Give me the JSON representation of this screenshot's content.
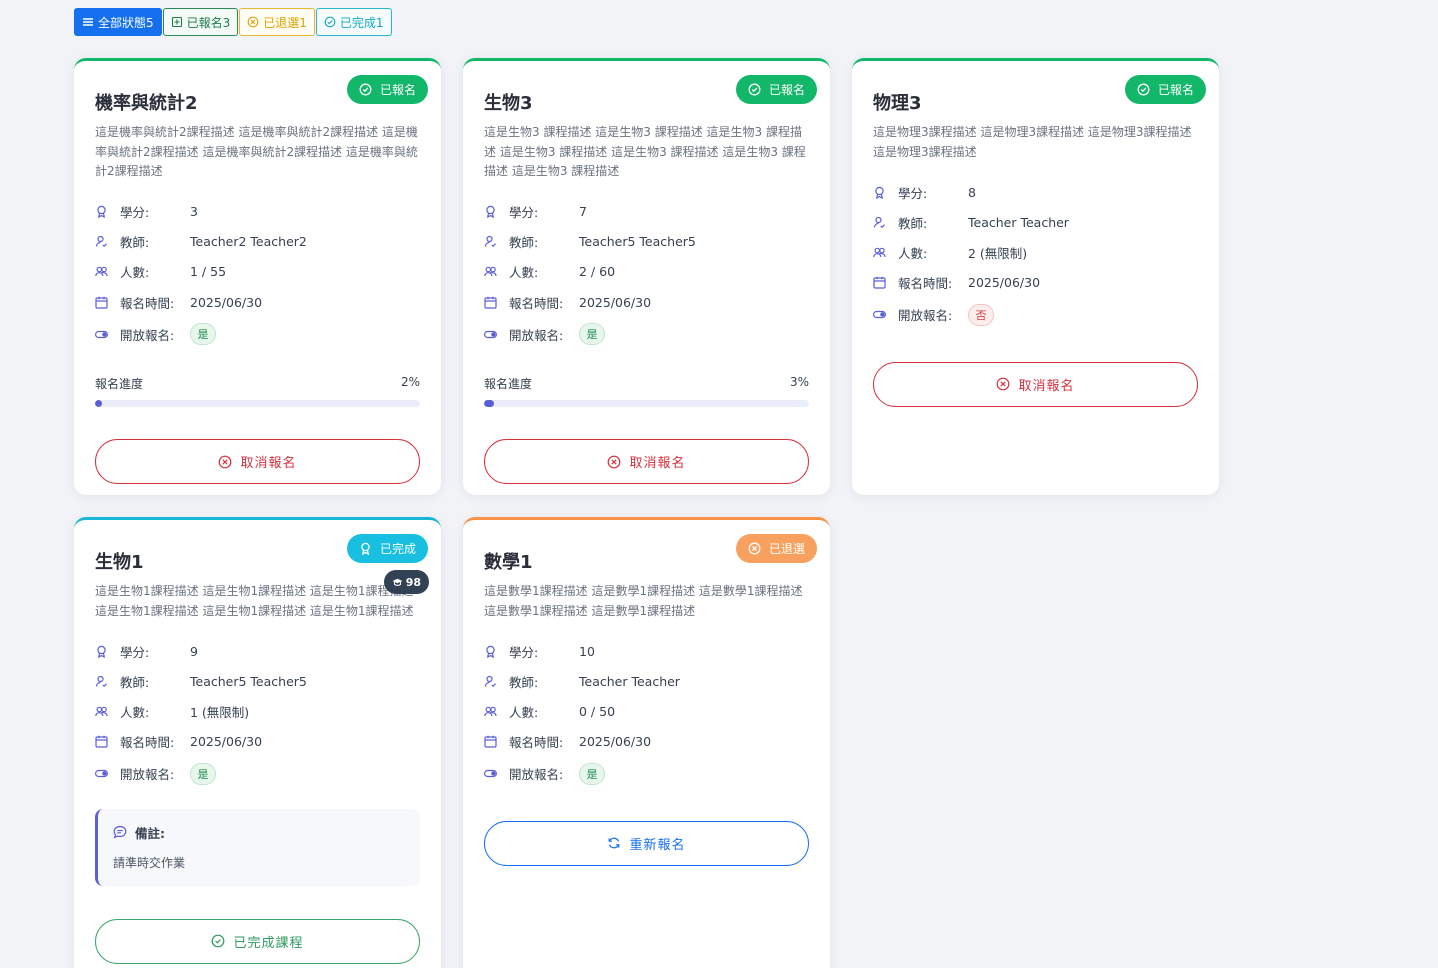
{
  "colors": {
    "primary": "#1570ef",
    "registered": "#12b76a",
    "completed": "#18bfe0",
    "withdrawn": "#f8a15e",
    "cancel": "#d6313d",
    "progress": "#5b5fd6"
  },
  "filters": {
    "all": "全部狀態5",
    "registered": "已報名3",
    "withdrawn": "已退選1",
    "completed": "已完成1"
  },
  "labels": {
    "credits": "學分:",
    "teacher": "教師:",
    "people": "人數:",
    "reg_time": "報名時間:",
    "open_reg": "開放報名:",
    "progress": "報名進度",
    "note": "備註:"
  },
  "courses": [
    {
      "status": "已報名",
      "status_icon": "check-circle-icon",
      "title": "機率與統計2",
      "description": "這是機率與統計2課程描述 這是機率與統計2課程描述 這是機率與統計2課程描述 這是機率與統計2課程描述 這是機率與統計2課程描述",
      "credits": "3",
      "teacher": "Teacher2 Teacher2",
      "people": "1 / 55",
      "reg_time": "2025/06/30",
      "open": "是",
      "progress_pct": "2%",
      "progress_value": 2,
      "action": "取消報名"
    },
    {
      "status": "已報名",
      "status_icon": "check-circle-icon",
      "title": "生物3",
      "description": "這是生物3 課程描述 這是生物3 課程描述 這是生物3 課程描述 這是生物3 課程描述 這是生物3 課程描述 這是生物3 課程描述 這是生物3 課程描述",
      "credits": "7",
      "teacher": "Teacher5 Teacher5",
      "people": "2 / 60",
      "reg_time": "2025/06/30",
      "open": "是",
      "progress_pct": "3%",
      "progress_value": 3,
      "action": "取消報名"
    },
    {
      "status": "已報名",
      "status_icon": "check-circle-icon",
      "title": "物理3",
      "description": "這是物理3課程描述 這是物理3課程描述 這是物理3課程描述 這是物理3課程描述",
      "credits": "8",
      "teacher": "Teacher Teacher",
      "people": "2 (無限制)",
      "reg_time": "2025/06/30",
      "open": "否",
      "action": "取消報名"
    },
    {
      "status": "已完成",
      "status_icon": "award-icon",
      "score": "98",
      "title": "生物1",
      "description": "這是生物1課程描述 這是生物1課程描述 這是生物1課程描述 這是生物1課程描述 這是生物1課程描述 這是生物1課程描述",
      "credits": "9",
      "teacher": "Teacher5 Teacher5",
      "people": "1 (無限制)",
      "reg_time": "2025/06/30",
      "open": "是",
      "note": "請準時交作業",
      "action": "已完成課程"
    },
    {
      "status": "已退選",
      "status_icon": "x-circle-icon",
      "title": "數學1",
      "description": "這是數學1課程描述 這是數學1課程描述 這是數學1課程描述 這是數學1課程描述 這是數學1課程描述",
      "credits": "10",
      "teacher": "Teacher Teacher",
      "people": "0 / 50",
      "reg_time": "2025/06/30",
      "open": "是",
      "action": "重新報名"
    }
  ]
}
